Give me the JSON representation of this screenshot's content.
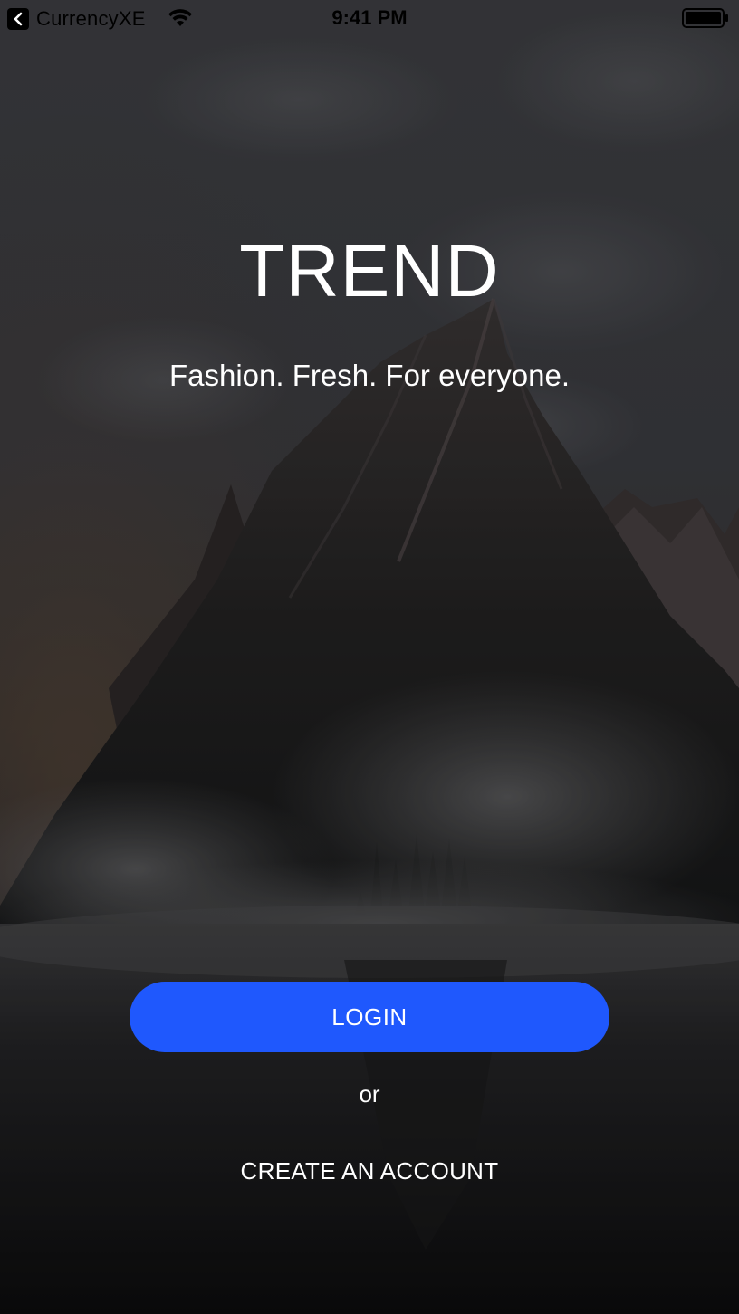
{
  "status_bar": {
    "back_app_label": "CurrencyXE",
    "time": "9:41 PM",
    "back_icon": "chevron-left-icon",
    "wifi_icon": "wifi-icon",
    "battery_icon": "battery-icon",
    "battery_level": 1.0
  },
  "hero": {
    "title": "TREND",
    "tagline": "Fashion. Fresh. For everyone."
  },
  "actions": {
    "login_label": "LOGIN",
    "separator": "or",
    "create_account_label": "CREATE AN ACCOUNT"
  },
  "colors": {
    "primary_button": "#1f58fd",
    "text": "#ffffff"
  },
  "background": "mountain-landscape-image"
}
